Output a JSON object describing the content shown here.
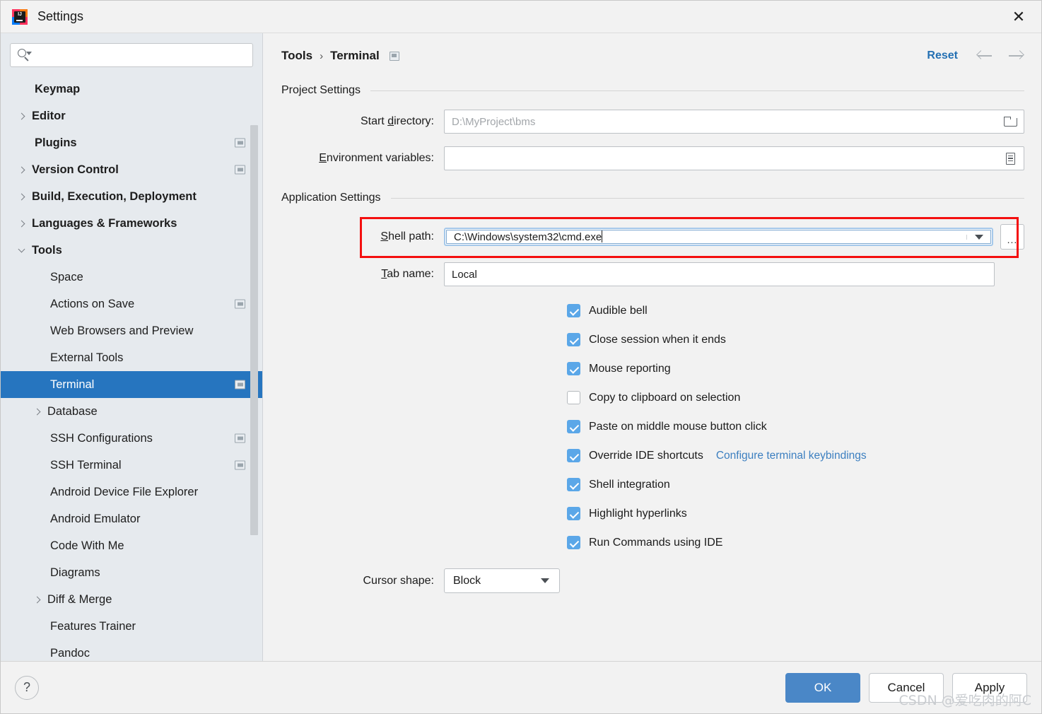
{
  "window": {
    "title": "Settings",
    "close_label": "✕",
    "app_icon": "intellij-idea-logo"
  },
  "sidebar": {
    "search": {
      "placeholder": "",
      "value": ""
    },
    "items": [
      {
        "label": "Keymap",
        "level": 0,
        "arrow": "none",
        "bold": true,
        "scope": false,
        "selected": false
      },
      {
        "label": "Editor",
        "level": 0,
        "arrow": "closed",
        "bold": true,
        "scope": false,
        "selected": false
      },
      {
        "label": "Plugins",
        "level": 0,
        "arrow": "none",
        "bold": true,
        "scope": true,
        "selected": false
      },
      {
        "label": "Version Control",
        "level": 0,
        "arrow": "closed",
        "bold": true,
        "scope": true,
        "selected": false
      },
      {
        "label": "Build, Execution, Deployment",
        "level": 0,
        "arrow": "closed",
        "bold": true,
        "scope": false,
        "selected": false
      },
      {
        "label": "Languages & Frameworks",
        "level": 0,
        "arrow": "closed",
        "bold": true,
        "scope": false,
        "selected": false
      },
      {
        "label": "Tools",
        "level": 0,
        "arrow": "open",
        "bold": true,
        "scope": false,
        "selected": false
      },
      {
        "label": "Space",
        "level": 1,
        "arrow": "none",
        "bold": false,
        "scope": false,
        "selected": false
      },
      {
        "label": "Actions on Save",
        "level": 1,
        "arrow": "none",
        "bold": false,
        "scope": true,
        "selected": false
      },
      {
        "label": "Web Browsers and Preview",
        "level": 1,
        "arrow": "none",
        "bold": false,
        "scope": false,
        "selected": false
      },
      {
        "label": "External Tools",
        "level": 1,
        "arrow": "none",
        "bold": false,
        "scope": false,
        "selected": false
      },
      {
        "label": "Terminal",
        "level": 1,
        "arrow": "none",
        "bold": false,
        "scope": true,
        "selected": true
      },
      {
        "label": "Database",
        "level": 1,
        "arrow": "closed",
        "bold": false,
        "scope": false,
        "selected": false
      },
      {
        "label": "SSH Configurations",
        "level": 1,
        "arrow": "none",
        "bold": false,
        "scope": true,
        "selected": false
      },
      {
        "label": "SSH Terminal",
        "level": 1,
        "arrow": "none",
        "bold": false,
        "scope": true,
        "selected": false
      },
      {
        "label": "Android Device File Explorer",
        "level": 1,
        "arrow": "none",
        "bold": false,
        "scope": false,
        "selected": false
      },
      {
        "label": "Android Emulator",
        "level": 1,
        "arrow": "none",
        "bold": false,
        "scope": false,
        "selected": false
      },
      {
        "label": "Code With Me",
        "level": 1,
        "arrow": "none",
        "bold": false,
        "scope": false,
        "selected": false
      },
      {
        "label": "Diagrams",
        "level": 1,
        "arrow": "none",
        "bold": false,
        "scope": false,
        "selected": false
      },
      {
        "label": "Diff & Merge",
        "level": 1,
        "arrow": "closed",
        "bold": false,
        "scope": false,
        "selected": false
      },
      {
        "label": "Features Trainer",
        "level": 1,
        "arrow": "none",
        "bold": false,
        "scope": false,
        "selected": false
      },
      {
        "label": "Pandoc",
        "level": 1,
        "arrow": "none",
        "bold": false,
        "scope": false,
        "selected": false
      }
    ]
  },
  "main": {
    "breadcrumb": {
      "parent": "Tools",
      "separator": "›",
      "current": "Terminal"
    },
    "reset_label": "Reset",
    "project_settings": {
      "title": "Project Settings",
      "start_directory": {
        "label": "Start directory:",
        "label_mnemonic": "d",
        "value": "D:\\MyProject\\bms"
      },
      "environment_variables": {
        "label": "Environment variables:",
        "label_mnemonic": "E",
        "value": ""
      }
    },
    "application_settings": {
      "title": "Application Settings",
      "shell_path": {
        "label": "Shell path:",
        "label_mnemonic": "S",
        "value": "C:\\Windows\\system32\\cmd.exe",
        "ellipsis_label": "..."
      },
      "tab_name": {
        "label": "Tab name:",
        "label_mnemonic": "T",
        "value": "Local"
      },
      "checkboxes": [
        {
          "label": "Audible bell",
          "checked": true
        },
        {
          "label": "Close session when it ends",
          "checked": true
        },
        {
          "label": "Mouse reporting",
          "checked": true
        },
        {
          "label": "Copy to clipboard on selection",
          "checked": false
        },
        {
          "label": "Paste on middle mouse button click",
          "checked": true
        },
        {
          "label": "Override IDE shortcuts",
          "checked": true,
          "link": "Configure terminal keybindings"
        },
        {
          "label": "Shell integration",
          "checked": true
        },
        {
          "label": "Highlight hyperlinks",
          "checked": true
        },
        {
          "label": "Run Commands using IDE",
          "checked": true
        }
      ],
      "cursor_shape": {
        "label": "Cursor shape:",
        "value": "Block"
      }
    }
  },
  "footer": {
    "help_label": "?",
    "ok_label": "OK",
    "cancel_label": "Cancel",
    "apply_label": "Apply"
  },
  "watermark": "CSDN @爱吃肉的阿C",
  "colors": {
    "selection_blue": "#2675bf",
    "accent_link": "#2470b3",
    "primary_button": "#4a87c7",
    "annotation_red": "#f40f0f",
    "checkbox_blue": "#5ba7e8",
    "sidebar_bg": "#e6eaee"
  }
}
